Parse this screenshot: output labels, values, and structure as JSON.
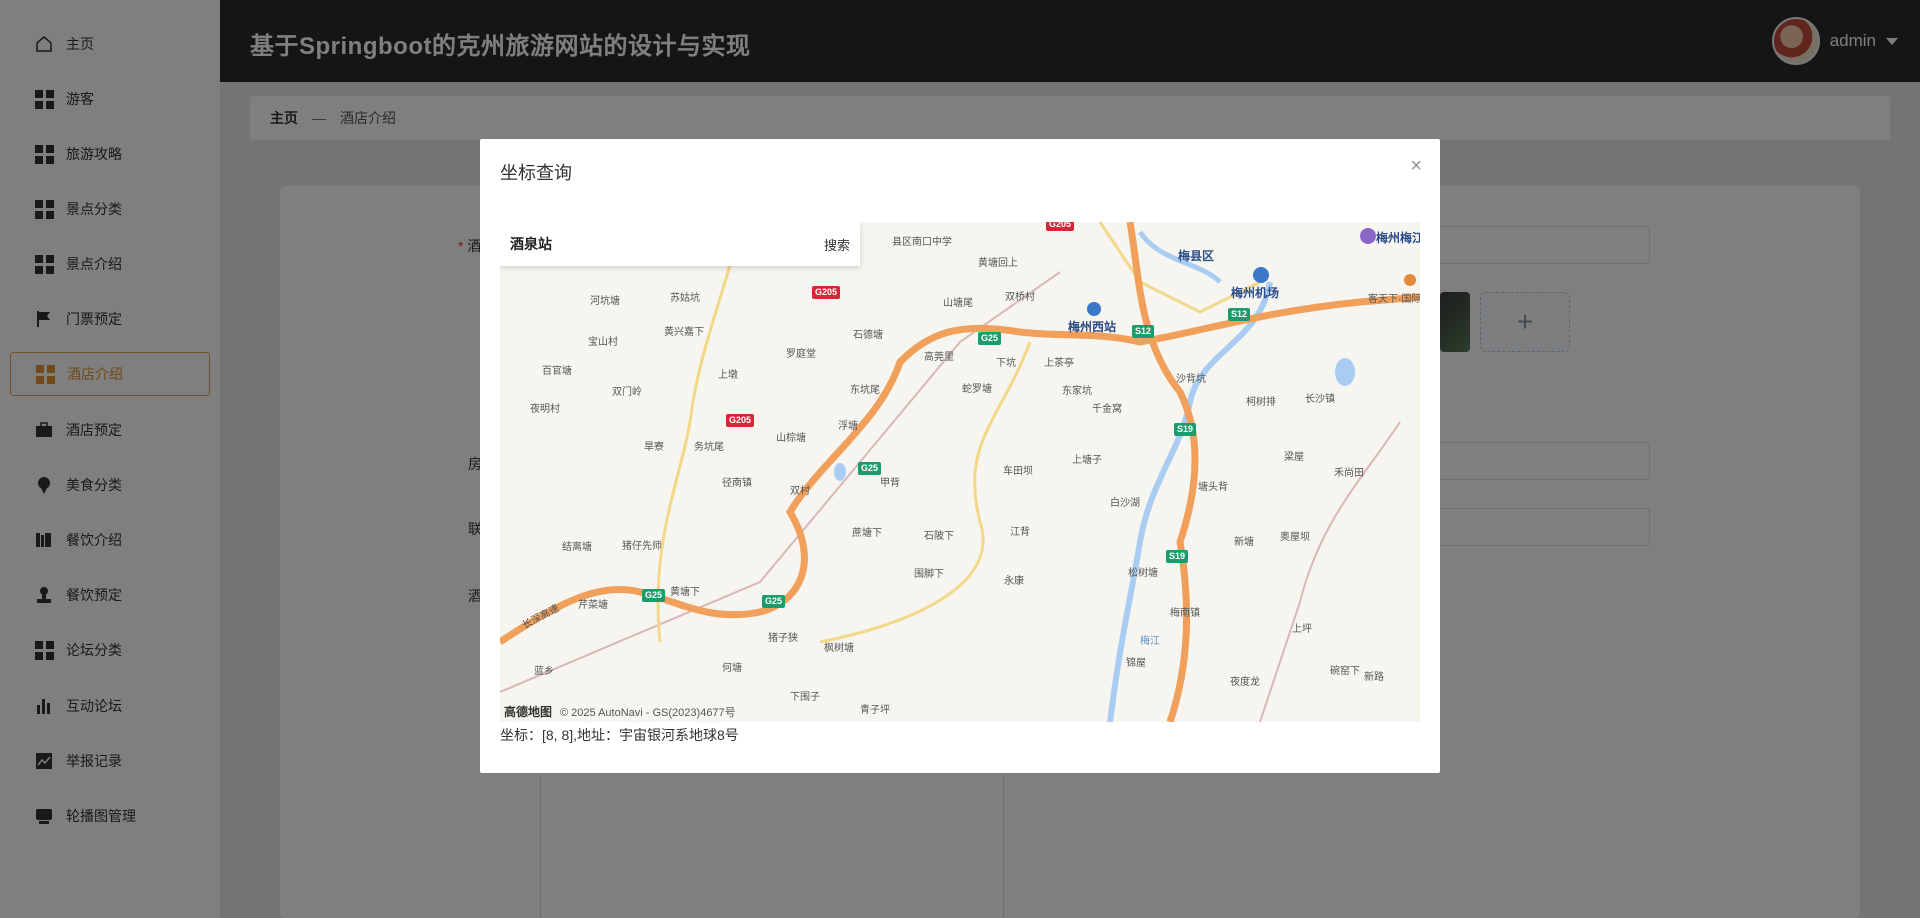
{
  "sidebar": {
    "items": [
      {
        "label": "主页",
        "icon": "home-icon"
      },
      {
        "label": "游客",
        "icon": "grid-icon"
      },
      {
        "label": "旅游攻略",
        "icon": "grid-icon"
      },
      {
        "label": "景点分类",
        "icon": "grid-icon"
      },
      {
        "label": "景点介绍",
        "icon": "grid-icon"
      },
      {
        "label": "门票预定",
        "icon": "flag-icon"
      },
      {
        "label": "酒店介绍",
        "icon": "grid-icon",
        "active": true
      },
      {
        "label": "酒店预定",
        "icon": "briefcase-icon"
      },
      {
        "label": "美食分类",
        "icon": "pin-icon"
      },
      {
        "label": "餐饮介绍",
        "icon": "books-icon"
      },
      {
        "label": "餐饮预定",
        "icon": "stamp-icon"
      },
      {
        "label": "论坛分类",
        "icon": "grid-icon"
      },
      {
        "label": "互动论坛",
        "icon": "bar-chart-icon"
      },
      {
        "label": "举报记录",
        "icon": "trend-icon"
      },
      {
        "label": "轮播图管理",
        "icon": "monitor-icon"
      }
    ]
  },
  "header": {
    "title": "基于Springboot的克州旅游网站的设计与实现",
    "username": "admin"
  },
  "breadcrumb": {
    "home": "主页",
    "separator": "—",
    "current": "酒店介绍"
  },
  "form_labels": {
    "l1": "酒",
    "l2": "房",
    "l3": "联",
    "l4": "酒"
  },
  "dialog": {
    "title": "坐标查询",
    "close": "×",
    "search_value": "酒泉站",
    "search_button": "搜索",
    "coords_text": "坐标：[8, 8],地址：宇宙银河系地球8号",
    "map_brand": "高德地图",
    "map_copyright": "© 2025 AutoNavi - GS(2023)4677号",
    "places": {
      "p1": "县区南口中学",
      "p2": "梅县区",
      "p3": "梅州梅江",
      "p4": "梅州机场",
      "p5": "梅州西站",
      "p6": "客天下·国际旅游",
      "p7": "长沙镇",
      "p8": "梅南镇",
      "p9": "黄塘回上",
      "p10": "山塘尾",
      "p11": "双桥村",
      "p12": "石德塘",
      "p13": "高莞里",
      "p14": "下坑",
      "p15": "上茶亭",
      "p16": "河坑塘",
      "p17": "苏姑坑",
      "p18": "黄兴嘉下",
      "p19": "宝山村",
      "p20": "百官塘",
      "p21": "双门岭",
      "p22": "夜明村",
      "p23": "罗庭堂",
      "p24": "上墩",
      "p25": "东坑尾",
      "p26": "蛇罗塘",
      "p27": "东家坑",
      "p28": "千金窝",
      "p29": "沙背坑",
      "p30": "柯树排",
      "p31": "浮塘",
      "p32": "山棕塘",
      "p33": "务坑尾",
      "p34": "旱寮",
      "p35": "径南镇",
      "p36": "双村",
      "p37": "甲背",
      "p38": "车田坝",
      "p39": "上塘子",
      "p40": "白沙湖",
      "p41": "塘头背",
      "p42": "禾尚田",
      "p43": "新塘",
      "p44": "奥屋坝",
      "p45": "芹菜塘",
      "p46": "黄塘下",
      "p47": "蔗塘下",
      "p48": "石陂下",
      "p49": "江背",
      "p50": "永康",
      "p51": "围脚下",
      "p52": "猪子狭",
      "p53": "枫树塘",
      "p54": "何塘",
      "p55": "下围子",
      "p56": "青子坪",
      "p57": "蓝乡",
      "p58": "上坪",
      "p59": "夜度龙",
      "p60": "松树塘",
      "p61": "长深高速",
      "p62": "梅江",
      "p63": "锦屋",
      "p64": "猪仔先师",
      "p65": "结离塘",
      "p66": "梁屋",
      "p67": "碗窑下",
      "p68": "新路"
    },
    "shields": {
      "s1": "G205",
      "s2": "G205",
      "s3": "G205",
      "s4": "G25",
      "s5": "G25",
      "s6": "G25",
      "s7": "G25",
      "s8": "S12",
      "s9": "S12",
      "s10": "S19",
      "s11": "S19"
    }
  },
  "colors": {
    "accent": "#e59435",
    "header_bg": "#2a2a2a",
    "highway": "#f0a05a"
  }
}
